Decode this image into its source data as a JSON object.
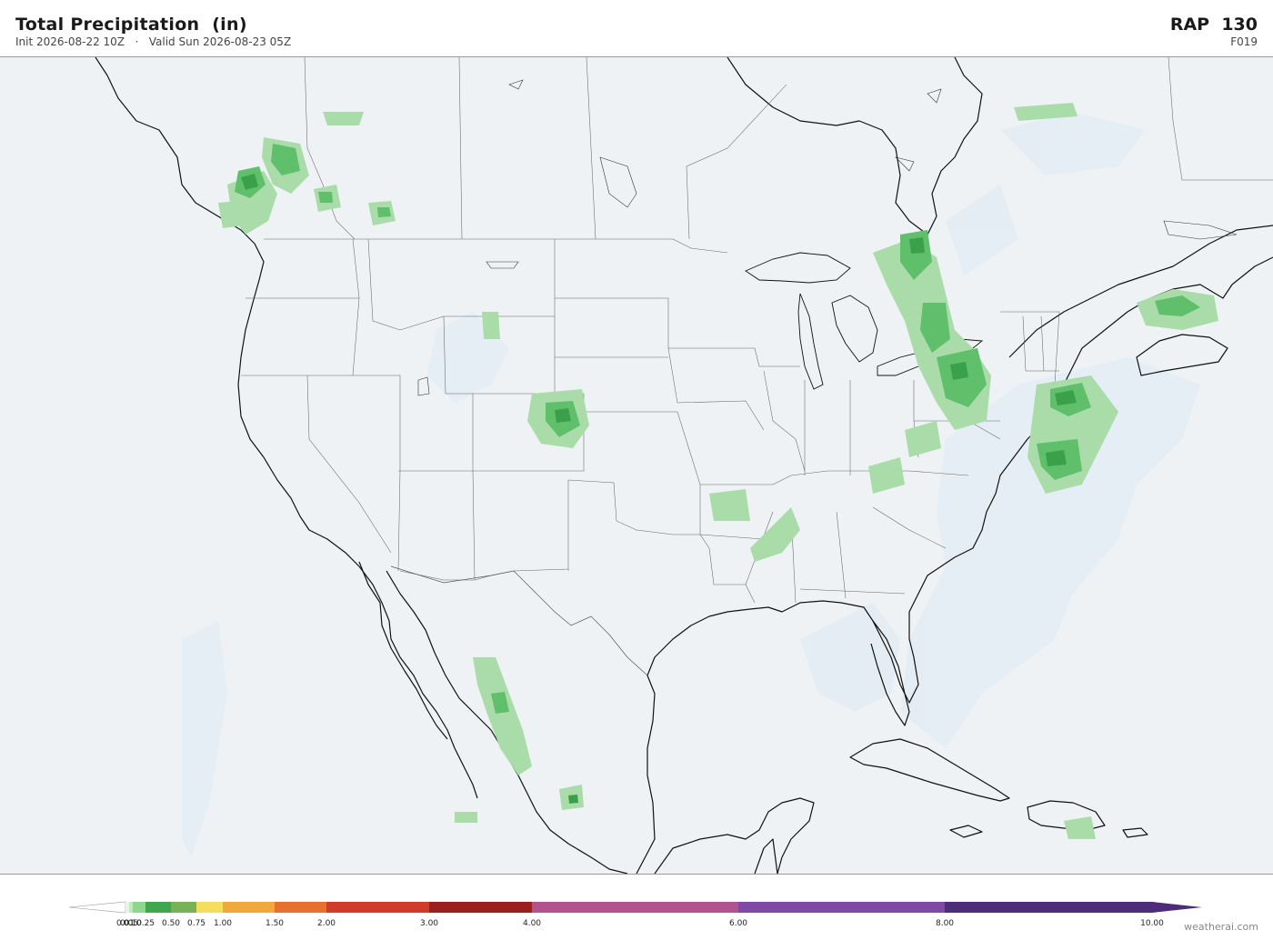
{
  "header": {
    "title": "Total Precipitation  (in)",
    "subtitle": "Init 2026-08-22 10Z   ·   Valid Sun 2026-08-23 05Z",
    "model": "RAP  130",
    "forecast_hour": "F019"
  },
  "colorbar": {
    "ticks": [
      "0.01",
      "0.05",
      "0.10",
      "0.25",
      "0.50",
      "0.75",
      "1.00",
      "1.50",
      "2.00",
      "3.00",
      "4.00",
      "6.00",
      "8.00",
      "10.00"
    ],
    "bins": [
      {
        "from": 0.01,
        "to": 0.05,
        "color": "#e6f5e6"
      },
      {
        "from": 0.05,
        "to": 0.1,
        "color": "#c2e8c2"
      },
      {
        "from": 0.1,
        "to": 0.25,
        "color": "#8fd48f"
      },
      {
        "from": 0.25,
        "to": 0.5,
        "color": "#3fa84f"
      },
      {
        "from": 0.5,
        "to": 0.75,
        "color": "#77b356"
      },
      {
        "from": 0.75,
        "to": 1.0,
        "color": "#f3df5c"
      },
      {
        "from": 1.0,
        "to": 1.5,
        "color": "#f2a93b"
      },
      {
        "from": 1.5,
        "to": 2.0,
        "color": "#e8702f"
      },
      {
        "from": 2.0,
        "to": 3.0,
        "color": "#d13b2a"
      },
      {
        "from": 3.0,
        "to": 4.0,
        "color": "#9c1f1f"
      },
      {
        "from": 4.0,
        "to": 6.0,
        "color": "#b0538f"
      },
      {
        "from": 6.0,
        "to": 8.0,
        "color": "#7f4aa6"
      },
      {
        "from": 8.0,
        "to": 10.0,
        "color": "#4d2c7a"
      }
    ]
  },
  "precip_colors": {
    "trace": "#e6f5e6",
    "light": "#a9dca9",
    "moderate": "#5fbf6a",
    "heavy": "#3aa14a"
  },
  "credit": "weatherai.com"
}
